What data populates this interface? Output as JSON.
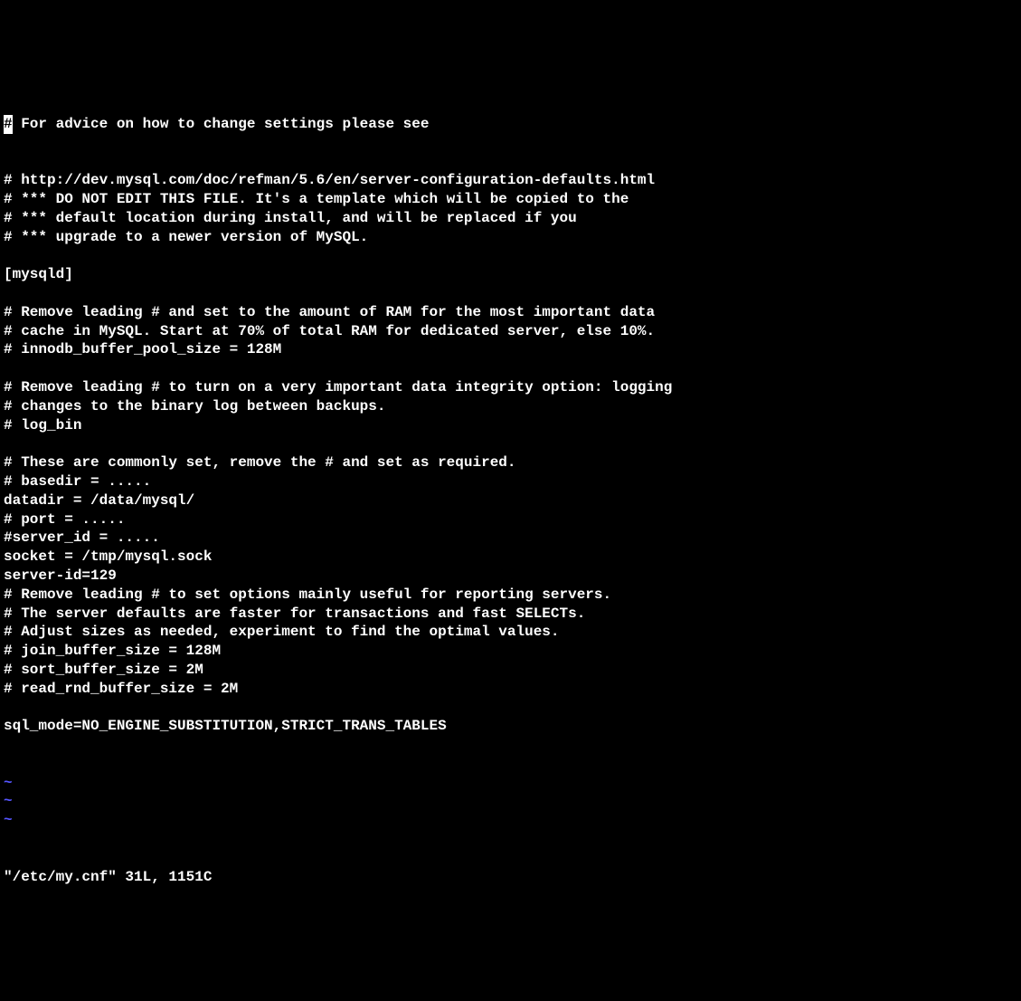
{
  "cursor_char": "#",
  "cursor_rest": " For advice on how to change settings please see",
  "lines": [
    "# http://dev.mysql.com/doc/refman/5.6/en/server-configuration-defaults.html",
    "# *** DO NOT EDIT THIS FILE. It's a template which will be copied to the",
    "# *** default location during install, and will be replaced if you",
    "# *** upgrade to a newer version of MySQL.",
    "",
    "[mysqld]",
    "",
    "# Remove leading # and set to the amount of RAM for the most important data",
    "# cache in MySQL. Start at 70% of total RAM for dedicated server, else 10%.",
    "# innodb_buffer_pool_size = 128M",
    "",
    "# Remove leading # to turn on a very important data integrity option: logging",
    "# changes to the binary log between backups.",
    "# log_bin",
    "",
    "# These are commonly set, remove the # and set as required.",
    "# basedir = .....",
    "datadir = /data/mysql/",
    "# port = .....",
    "#server_id = .....",
    "socket = /tmp/mysql.sock",
    "server-id=129",
    "# Remove leading # to set options mainly useful for reporting servers.",
    "# The server defaults are faster for transactions and fast SELECTs.",
    "# Adjust sizes as needed, experiment to find the optimal values.",
    "# join_buffer_size = 128M",
    "# sort_buffer_size = 2M",
    "# read_rnd_buffer_size = 2M",
    "",
    "sql_mode=NO_ENGINE_SUBSTITUTION,STRICT_TRANS_TABLES"
  ],
  "tildes": [
    "~",
    "~",
    "~"
  ],
  "status": "\"/etc/my.cnf\" 31L, 1151C"
}
